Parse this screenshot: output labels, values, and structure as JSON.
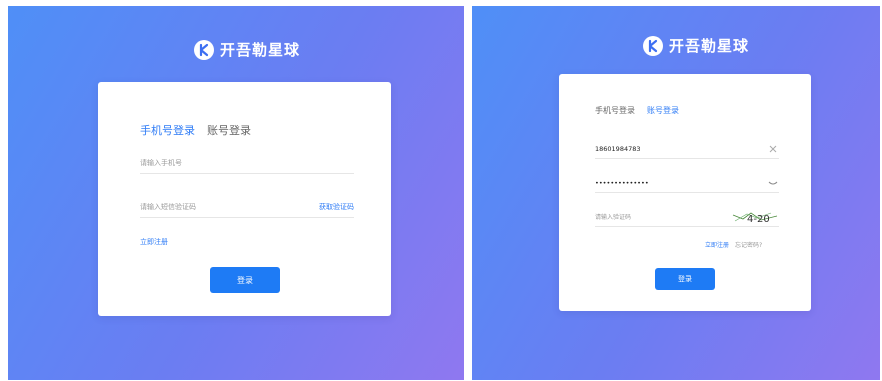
{
  "brand": {
    "name": "开吾勒星球"
  },
  "left": {
    "tabs": [
      "手机号登录",
      "账号登录"
    ],
    "phone_placeholder": "请输入手机号",
    "code_placeholder": "请输入短信验证码",
    "get_code": "获取验证码",
    "register": "立即注册",
    "login": "登录"
  },
  "right": {
    "tabs": [
      "手机号登录",
      "账号登录"
    ],
    "account_value": "18601984783",
    "password_value": "••••••••••••••",
    "captcha_placeholder": "请输入验证码",
    "captcha_text": "4-20",
    "register": "立即注册",
    "forgot": "忘记密码?",
    "login": "登录"
  },
  "colors": {
    "accent": "#2f7cf6",
    "button": "#1e7bf5"
  }
}
